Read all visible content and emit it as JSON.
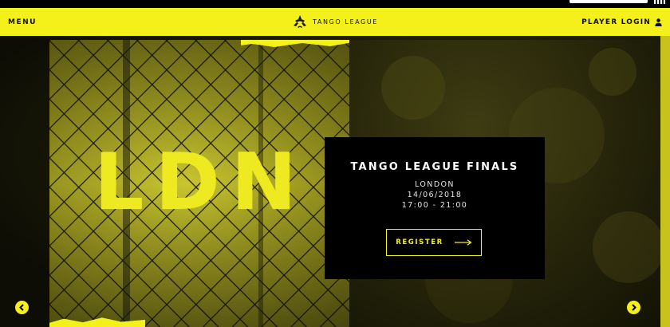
{
  "nav": {
    "menu_label": "MENU",
    "brand_label": "TANGO LEAGUE",
    "login_label": "PLAYER LOGIN"
  },
  "hero": {
    "city_code": "LDN"
  },
  "event": {
    "title": "TANGO LEAGUE FINALS",
    "location": "LONDON",
    "date": "14/06/2018",
    "time": "17:00 - 21:00",
    "register_label": "REGISTER"
  },
  "colors": {
    "accent": "#f4f01a",
    "card_bg": "#000000"
  },
  "icons": {
    "brand": "tango-logo-icon",
    "login": "user-icon",
    "register": "arrow-right-icon",
    "prev": "chevron-left-icon",
    "next": "chevron-right-icon"
  }
}
